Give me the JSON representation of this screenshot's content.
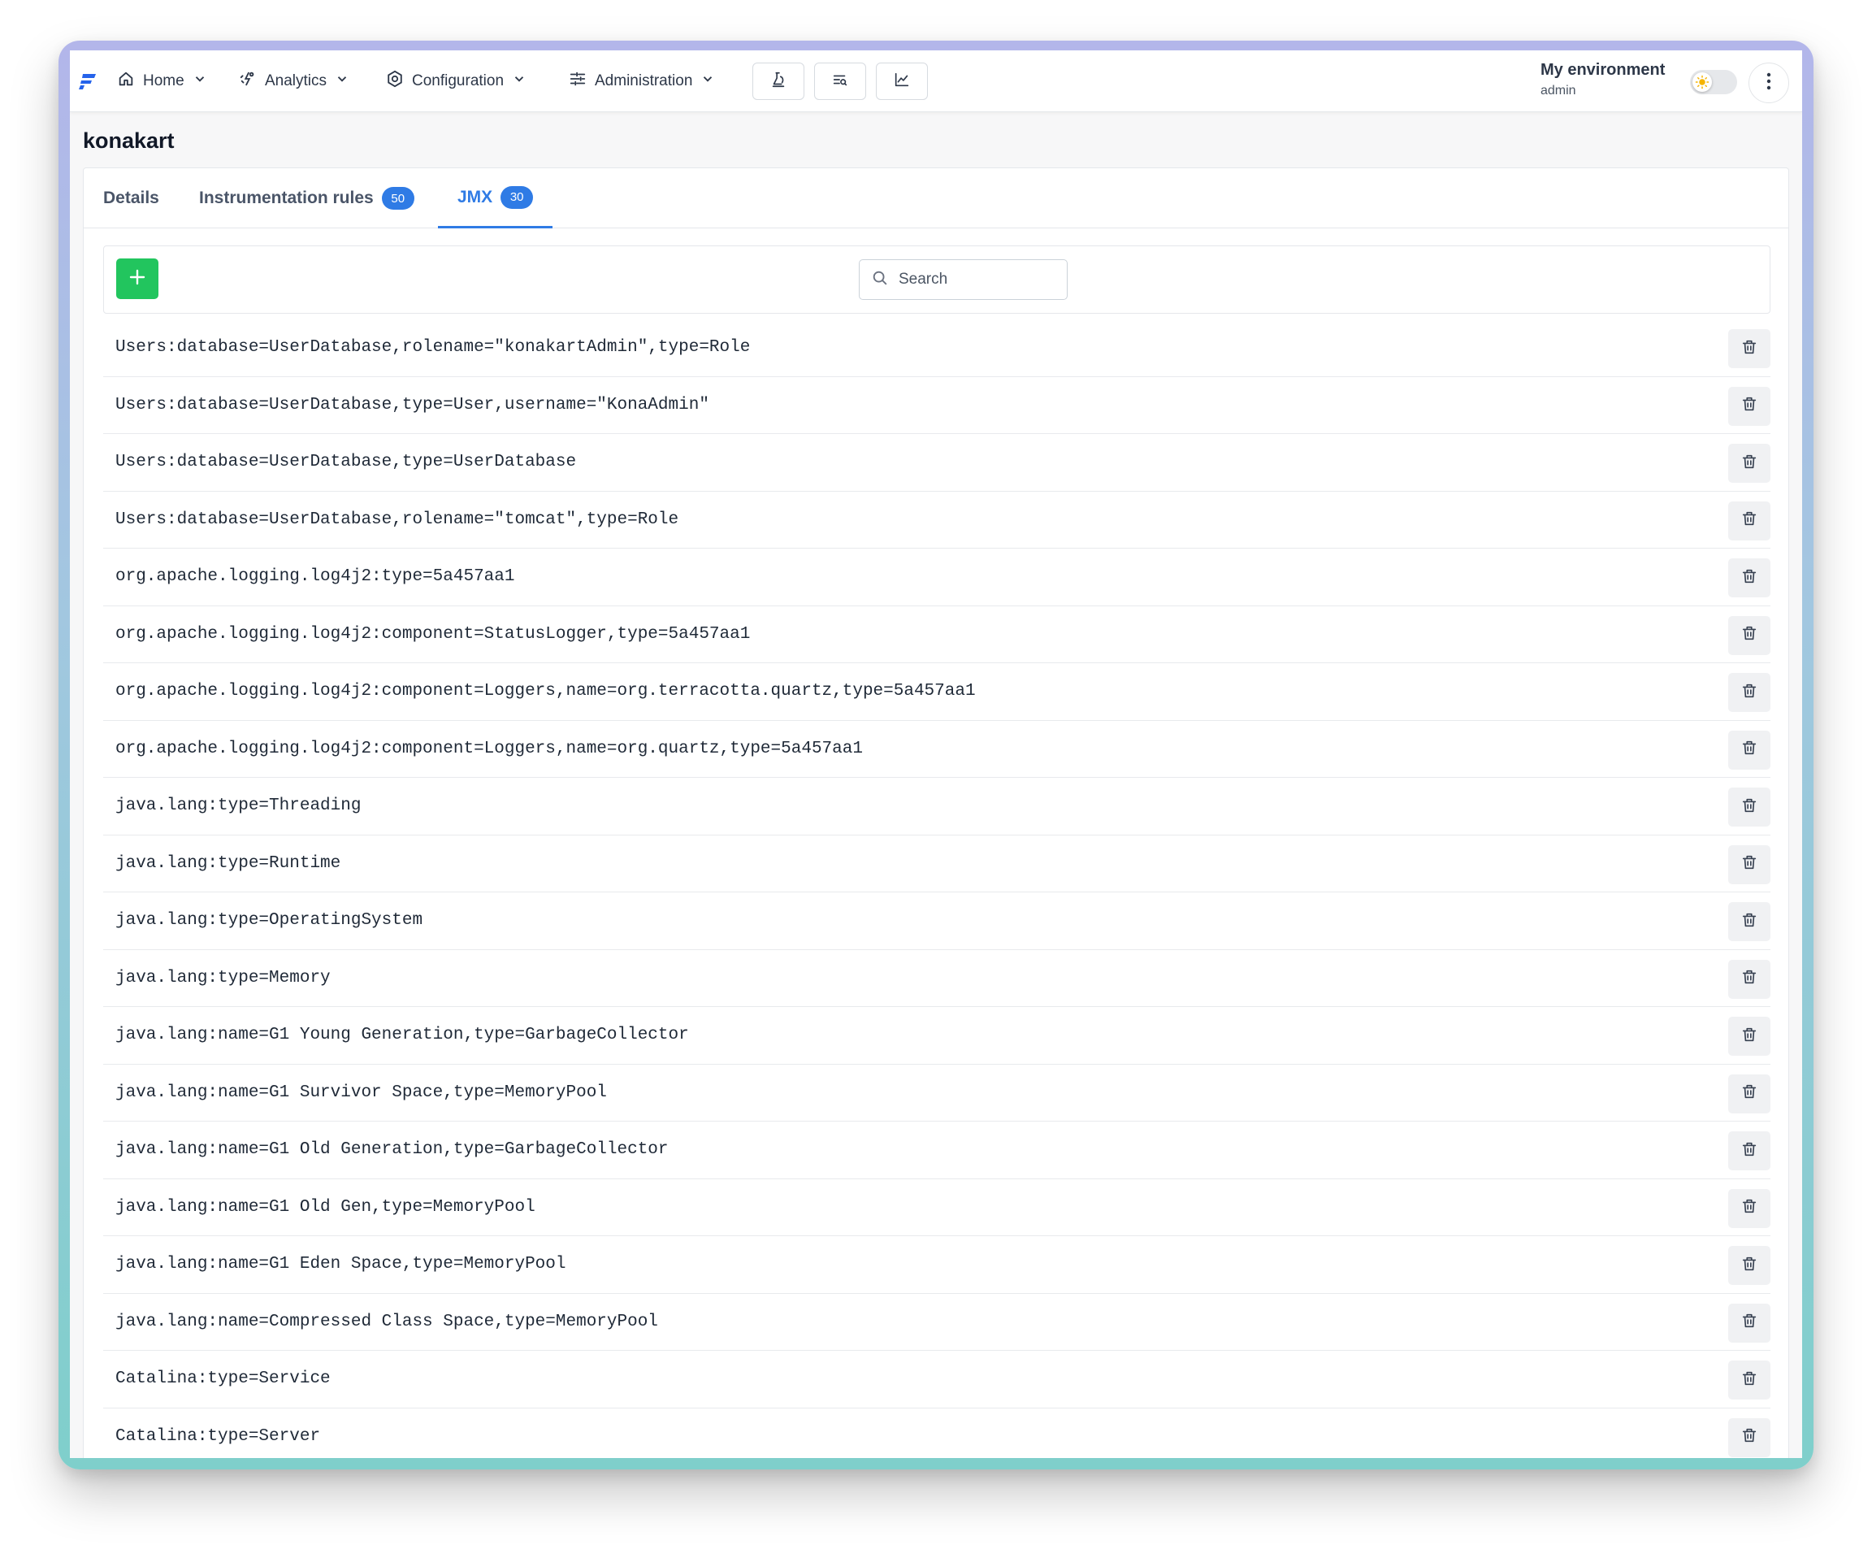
{
  "nav": {
    "home": "Home",
    "analytics": "Analytics",
    "configuration": "Configuration",
    "administration": "Administration",
    "icon_buttons": [
      "flask-icon",
      "list-search-icon",
      "line-chart-icon"
    ]
  },
  "environment": {
    "title": "My environment",
    "user": "admin"
  },
  "page": {
    "title": "konakart"
  },
  "tabs": [
    {
      "label": "Details",
      "badge": ""
    },
    {
      "label": "Instrumentation rules",
      "badge": "50"
    },
    {
      "label": "JMX",
      "badge": "30"
    }
  ],
  "search": {
    "placeholder": "Search"
  },
  "colors": {
    "accent": "#2f7be5",
    "add_button": "#22c55e"
  },
  "jmx_rows": [
    "Users:database=UserDatabase,rolename=\"konakartAdmin\",type=Role",
    "Users:database=UserDatabase,type=User,username=\"KonaAdmin\"",
    "Users:database=UserDatabase,type=UserDatabase",
    "Users:database=UserDatabase,rolename=\"tomcat\",type=Role",
    "org.apache.logging.log4j2:type=5a457aa1",
    "org.apache.logging.log4j2:component=StatusLogger,type=5a457aa1",
    "org.apache.logging.log4j2:component=Loggers,name=org.terracotta.quartz,type=5a457aa1",
    "org.apache.logging.log4j2:component=Loggers,name=org.quartz,type=5a457aa1",
    "java.lang:type=Threading",
    "java.lang:type=Runtime",
    "java.lang:type=OperatingSystem",
    "java.lang:type=Memory",
    "java.lang:name=G1 Young Generation,type=GarbageCollector",
    "java.lang:name=G1 Survivor Space,type=MemoryPool",
    "java.lang:name=G1 Old Generation,type=GarbageCollector",
    "java.lang:name=G1 Old Gen,type=MemoryPool",
    "java.lang:name=G1 Eden Space,type=MemoryPool",
    "java.lang:name=Compressed Class Space,type=MemoryPool",
    "Catalina:type=Service",
    "Catalina:type=Server"
  ]
}
